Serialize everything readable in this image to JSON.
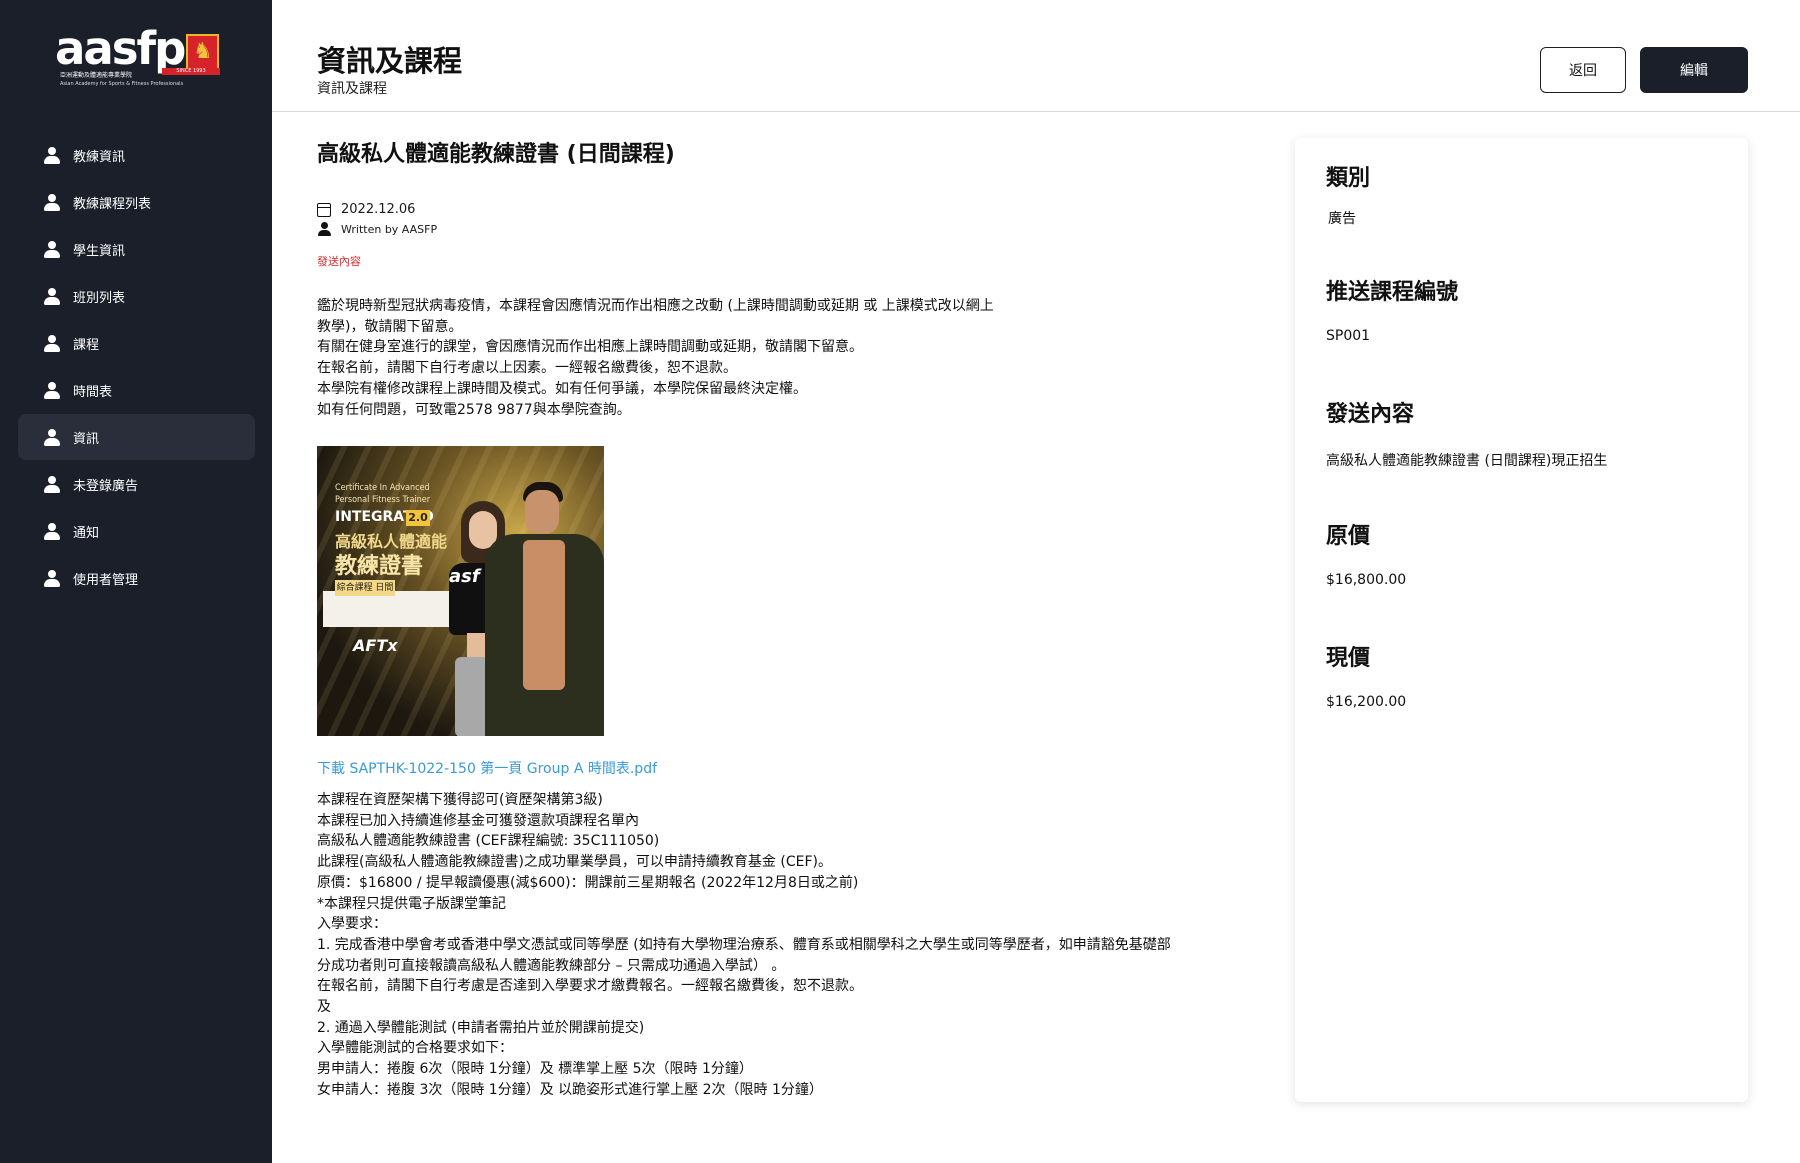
{
  "logo": {
    "text": "aasfp",
    "since": "SINCE 1993",
    "sub_cn": "亞洲運動及體適能專業學院",
    "sub_en": "Asian Academy for Sports & Fitness Professionals"
  },
  "sidebar": {
    "items": [
      {
        "label": "教練資訊",
        "icon": "user-icon"
      },
      {
        "label": "教練課程列表",
        "icon": "user-icon"
      },
      {
        "label": "學生資訊",
        "icon": "user-icon"
      },
      {
        "label": "班別列表",
        "icon": "user-icon"
      },
      {
        "label": "課程",
        "icon": "user-icon"
      },
      {
        "label": "時間表",
        "icon": "user-icon"
      },
      {
        "label": "資訊",
        "icon": "user-icon",
        "active": true
      },
      {
        "label": "未登錄廣告",
        "icon": "user-icon"
      },
      {
        "label": "通知",
        "icon": "user-icon"
      },
      {
        "label": "使用者管理",
        "icon": "user-icon"
      }
    ]
  },
  "header": {
    "title": "資訊及課程",
    "breadcrumb": "資訊及課程",
    "back_label": "返回",
    "edit_label": "編輯"
  },
  "article": {
    "title": "高級私人體適能教練證書 (日間課程)",
    "date": "2022.12.06",
    "author": "Written by  AASFP",
    "tag": "發送內容",
    "intro": [
      "鑑於現時新型冠狀病毒疫情，本課程會因應情況而作出相應之改動 (上課時間調動或延期 或 上課模式改以網上",
      "教學)，敬請閣下留意。",
      "有關在健身室進行的課堂，會因應情況而作出相應上課時間調動或延期，敬請閣下留意。",
      "在報名前，請閣下自行考慮以上因素。一經報名繳費後，恕不退款。",
      "本學院有權修改課程上課時間及模式。如有任何爭議，本學院保留最終決定權。",
      "如有任何問題，可致電2578 9877與本學院查詢。"
    ],
    "image": {
      "line1": "Certificate In Advanced",
      "line2": "Personal Fitness Trainer",
      "line3": "INTEGRATED",
      "badge": "2.0",
      "cn1": "高級私人體適能",
      "cn2": "教練證書",
      "tag": "綜合課程 日間",
      "brand": "asf",
      "aftx": "AFTx"
    },
    "download": "下載 SAPTHK-1022-150 第一頁 Group A 時間表.pdf",
    "details": [
      "本課程在資歷架構下獲得認可(資歷架構第3級)",
      "本課程已加入持續進修基金可獲發還款項課程名單內",
      "高級私人體適能教練證書 (CEF課程編號: 35C111050)",
      "此課程(高級私人體適能教練證書)之成功畢業學員，可以申請持續教育基金 (CEF)。",
      "原價：$16800 / 提早報讀優惠(減$600)：開課前三星期報名 (2022年12月8日或之前)",
      "*本課程只提供電子版課堂筆記",
      "入學要求：",
      "1. 完成香港中學會考或香港中學文憑試或同等學歷 (如持有大學物理治療系、體育系或相關學科之大學生或同等學歷者，如申請豁免基礎部",
      "分成功者則可直接報讀高級私人體適能教練部分 – 只需成功通過入學試） 。",
      "在報名前，請閣下自行考慮是否達到入學要求才繳費報名。一經報名繳費後，恕不退款。",
      "及",
      "2. 通過入學體能測試 (申請者需拍片並於開課前提交)",
      "入學體能測試的合格要求如下：",
      "男申請人：捲腹 6次（限時 1分鐘）及 標準掌上壓 5次（限時 1分鐘）",
      "女申請人：捲腹 3次（限時 1分鐘）及 以跪姿形式進行掌上壓 2次（限時 1分鐘）"
    ]
  },
  "card": {
    "category_label": "類別",
    "category_value": "廣告",
    "course_code_label": "推送課程編號",
    "course_code_value": "SP001",
    "content_label": "發送內容",
    "content_value": "高級私人體適能教練證書 (日間課程)現正招生",
    "original_price_label": "原價",
    "original_price_value": "$16,800.00",
    "current_price_label": "現價",
    "current_price_value": "$16,200.00"
  }
}
